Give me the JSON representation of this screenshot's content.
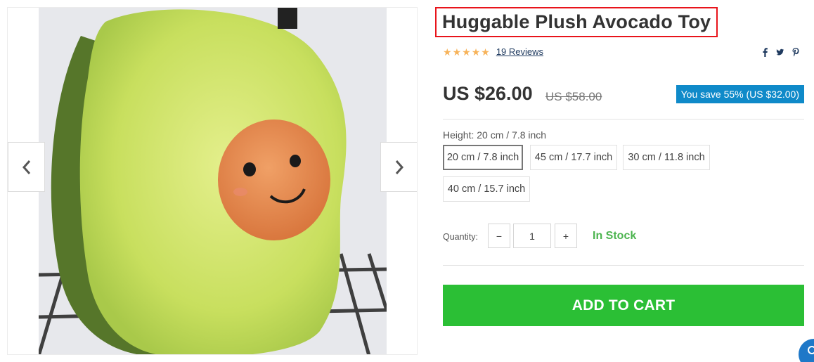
{
  "product": {
    "title": "Huggable Plush Avocado Toy",
    "rating_stars": 5,
    "reviews_text": "19 Reviews",
    "price": "US $26.00",
    "old_price": "US $58.00",
    "savings": "You save 55% (US $32.00)",
    "variant": {
      "label": "Height:",
      "selected": "20 cm / 7.8 inch",
      "options": [
        "20 cm / 7.8 inch",
        "45 cm / 17.7 inch",
        "30 cm / 11.8 inch",
        "40 cm / 15.7 inch"
      ]
    },
    "quantity": {
      "label": "Quantity:",
      "value": "1",
      "minus": "−",
      "plus": "+"
    },
    "stock_status": "In Stock",
    "add_to_cart": "ADD TO CART"
  },
  "share_icons": [
    "facebook-icon",
    "twitter-icon",
    "pinterest-icon"
  ],
  "gallery": {
    "prev_icon": "chevron-left-icon",
    "next_icon": "chevron-right-icon"
  },
  "colors": {
    "accent_green": "#2bbf35",
    "badge_blue": "#0f8ac9",
    "star": "#f7b35a",
    "highlight_red": "#e8141b"
  }
}
